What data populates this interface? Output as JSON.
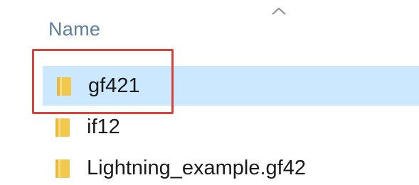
{
  "header": {
    "name_column_label": "Name",
    "sort_indicator_icon": "chevron-up-icon"
  },
  "files": [
    {
      "name": "gf421",
      "icon": "folder-icon",
      "selected": true,
      "highlighted": true
    },
    {
      "name": "if12",
      "icon": "folder-icon",
      "selected": false,
      "highlighted": false
    },
    {
      "name": "Lightning_example.gf42",
      "icon": "folder-icon",
      "selected": false,
      "highlighted": false
    }
  ],
  "colors": {
    "selection_background": "#cce8ff",
    "header_text": "#5d7d9c",
    "highlight_box": "#d9413a",
    "folder_yellow": "#f2c94c"
  }
}
